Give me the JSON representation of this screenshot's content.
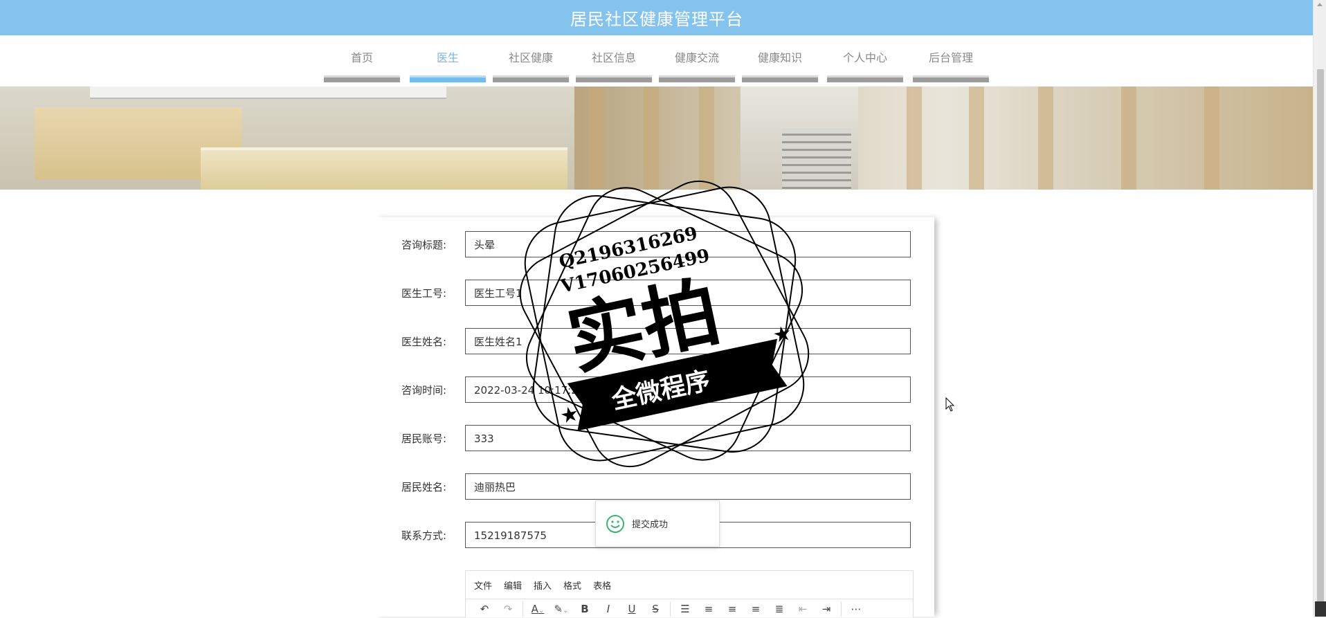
{
  "header": {
    "title": "居民社区健康管理平台"
  },
  "nav": {
    "items": [
      {
        "label": "首页",
        "active": false
      },
      {
        "label": "医生",
        "active": true
      },
      {
        "label": "社区健康",
        "active": false
      },
      {
        "label": "社区信息",
        "active": false
      },
      {
        "label": "健康交流",
        "active": false
      },
      {
        "label": "健康知识",
        "active": false
      },
      {
        "label": "个人中心",
        "active": false
      },
      {
        "label": "后台管理",
        "active": false
      }
    ]
  },
  "form": {
    "fields": [
      {
        "label": "咨询标题:",
        "value": "头晕"
      },
      {
        "label": "医生工号:",
        "value": "医生工号1"
      },
      {
        "label": "医生姓名:",
        "value": "医生姓名1"
      },
      {
        "label": "咨询时间:",
        "value": "2022-03-24 10:17:23"
      },
      {
        "label": "居民账号:",
        "value": "333"
      },
      {
        "label": "居民姓名:",
        "value": "迪丽热巴"
      },
      {
        "label": "联系方式:",
        "value": "15219187575"
      }
    ]
  },
  "editor": {
    "menus": [
      "文件",
      "编辑",
      "插入",
      "格式",
      "表格"
    ],
    "tools": [
      "undo-icon",
      "redo-icon",
      "font-color-icon",
      "highlight-icon",
      "bold-icon",
      "italic-icon",
      "underline-icon",
      "strikethrough-icon",
      "list-icon",
      "align-left-icon",
      "align-center-icon",
      "align-right-icon",
      "justify-icon",
      "outdent-icon",
      "indent-icon",
      "more-icon"
    ]
  },
  "toast": {
    "message": "提交成功"
  },
  "watermark": {
    "line1": "Q2196316269",
    "line2": "V17060256499",
    "main": "实拍",
    "ribbon": "全微程序"
  },
  "colors": {
    "header": "#85c3ef",
    "active": "#73bbed",
    "toast_icon": "#3cb371"
  }
}
